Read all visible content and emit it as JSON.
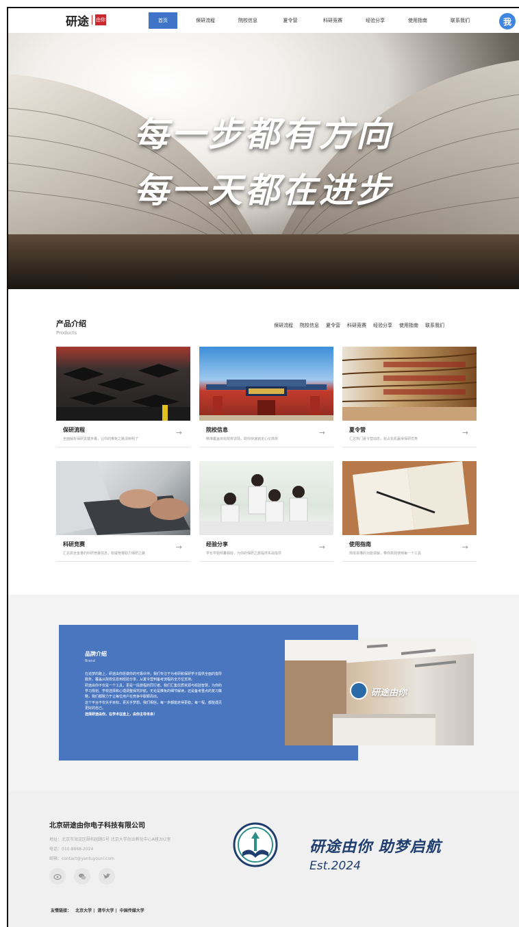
{
  "nav": {
    "logo_text": "研途",
    "logo_seal": "由你",
    "items": [
      "首页",
      "保研流程",
      "院校信息",
      "夏令营",
      "科研竞赛",
      "经验分享",
      "使用指南",
      "联系我们"
    ],
    "avatar": "我",
    "active_color": "#3f74c8"
  },
  "hero": {
    "line1": "每一步都有方向",
    "line2": "每一天都在进步"
  },
  "products": {
    "title": "产品介绍",
    "subtitle": "Products",
    "tabs": [
      "保研流程",
      "院校信息",
      "夏令营",
      "科研竞赛",
      "经验分享",
      "使用指南",
      "联系我们"
    ],
    "cards": [
      {
        "title": "保研流程",
        "desc": "全面解析保研关键步骤，让你的推免之路清晰明了",
        "image": "graduation-caps-photo"
      },
      {
        "title": "院校信息",
        "desc": "精准覆盖目标院校详情，助你快速锁定心仪高校",
        "image": "university-gate-photo"
      },
      {
        "title": "夏令营",
        "desc": "汇总热门夏令营动态，抢占先机赢得保研优势",
        "image": "library-bookshelf-photo"
      },
      {
        "title": "科研竞赛",
        "desc": "汇总高含金量的科研竞赛信息，权威竞赛助力保研之路",
        "image": "laptop-typing-photo"
      },
      {
        "title": "经验分享",
        "desc": "学长学姐倾囊相授，为你的保研之旅提供实战指导",
        "image": "students-studying-photo"
      },
      {
        "title": "使用指南",
        "desc": "简单易懂的功能讲解，带你高效使用每一个工具",
        "image": "notebook-pen-photo"
      }
    ]
  },
  "brand": {
    "title": "品牌介绍",
    "subtitle": "Brand",
    "paragraphs": [
      "在追梦的路上，研途由你愿做你的可靠伙伴。我们专注于为考研和保研学子提供全面的指导服务，覆盖从院校信息到经验分享，从夏令营到备考流程的全方位支持。",
      "研途由你不仅是一个工具，更是一段旅程的同行者。我们汇集优质资源与经验智慧，为你的学习规划、学校选择和心理调整保驾护航。无论是推免的细节解读，还是备考重点的复习策略，我们都致力于让每位用户在竞争中脱颖而出。",
      "这个平台不仅关乎目标，更关乎梦想。我们相信，每一步都能走得更稳；每一程，都能遇见更好的自己。",
      "选择研途由你，在学术征途上，由你主导未来！"
    ],
    "photo_sign": "研途由你",
    "box_color": "#4a76bf"
  },
  "footer": {
    "company": "北京研途由你电子科技有限公司",
    "address": "地址：北京市海淀区颐和园路5号 北京大学创业孵化中心A座302室",
    "phone": "电话：010-8888-2024",
    "email": "邮箱：contact@yantuyouni.com",
    "social_icons": [
      "weibo-icon",
      "wechat-icon",
      "twitter-icon"
    ],
    "slogan": "研途由你  助梦启航",
    "est": "Est.2024",
    "links_label": "友情链接：",
    "links": [
      "北京大学",
      "清华大学",
      "中国传媒大学"
    ],
    "brand_color": "#1f3d6d"
  }
}
